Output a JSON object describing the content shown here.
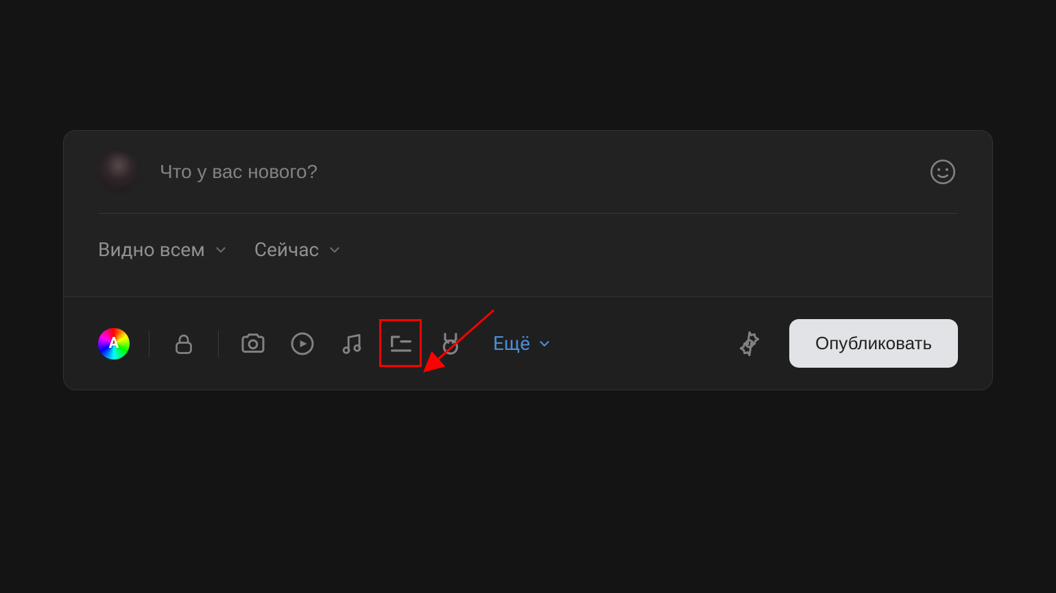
{
  "composer": {
    "placeholder": "Что у вас нового?",
    "visibility_label": "Видно всем",
    "timing_label": "Сейчас",
    "more_label": "Ещё",
    "publish_label": "Опубликовать",
    "color_letter": "A"
  },
  "icons": {
    "emoji": "emoji",
    "lock": "lock",
    "camera": "camera",
    "video": "video",
    "music": "music",
    "article": "article",
    "clips": "clips",
    "gear": "settings"
  },
  "annotation": {
    "highlight_target": "article-icon"
  }
}
